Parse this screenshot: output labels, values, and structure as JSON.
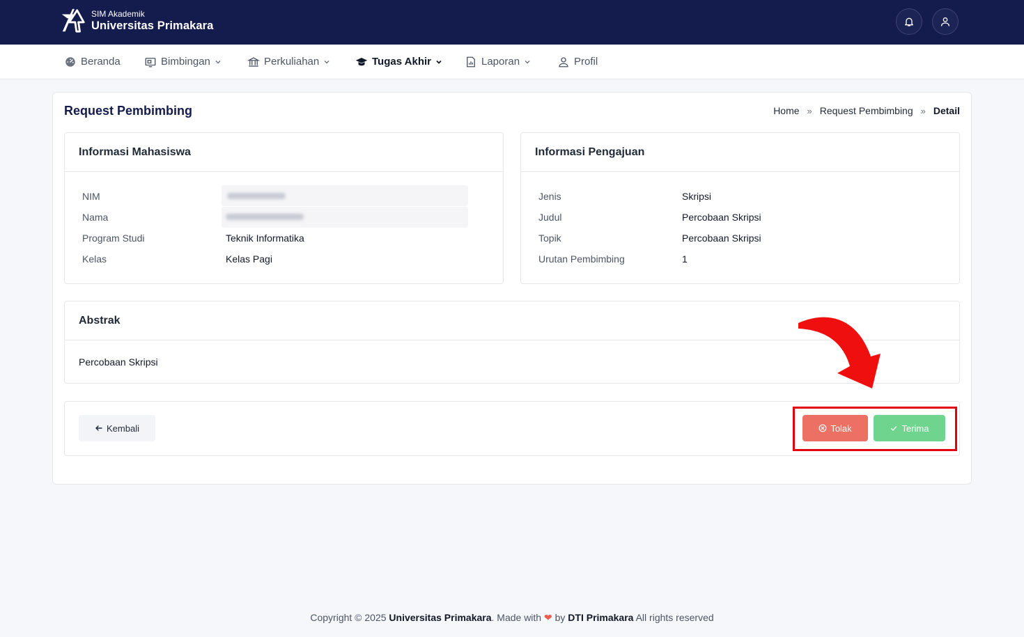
{
  "header": {
    "app_small": "SIM Akademik",
    "app_name": "Universitas Primakara",
    "icons": [
      "bell-icon",
      "user-icon"
    ]
  },
  "nav": {
    "items": [
      {
        "label": "Beranda",
        "icon": "dashboard-icon"
      },
      {
        "label": "Bimbingan",
        "icon": "monitor-icon",
        "dropdown": true
      },
      {
        "label": "Perkuliahan",
        "icon": "building-icon",
        "dropdown": true
      },
      {
        "label": "Tugas Akhir",
        "icon": "graduation-cap-icon",
        "dropdown": true,
        "active": true
      },
      {
        "label": "Laporan",
        "icon": "report-icon",
        "dropdown": true
      },
      {
        "label": "Profil",
        "icon": "user-icon"
      }
    ]
  },
  "page": {
    "title": "Request Pembimbing",
    "breadcrumb": [
      "Home",
      "Request Pembimbing",
      "Detail"
    ]
  },
  "student_info": {
    "title": "Informasi Mahasiswa",
    "rows": [
      {
        "label": "NIM",
        "value": "",
        "redacted": true
      },
      {
        "label": "Nama",
        "value": "",
        "redacted": true
      },
      {
        "label": "Program Studi",
        "value": "Teknik Informatika"
      },
      {
        "label": "Kelas",
        "value": "Kelas Pagi"
      }
    ]
  },
  "submission_info": {
    "title": "Informasi Pengajuan",
    "rows": [
      {
        "label": "Jenis",
        "value": "Skripsi"
      },
      {
        "label": "Judul",
        "value": "Percobaan Skripsi"
      },
      {
        "label": "Topik",
        "value": "Percobaan Skripsi"
      },
      {
        "label": "Urutan Pembimbing",
        "value": "1"
      }
    ]
  },
  "abstract": {
    "title": "Abstrak",
    "text": "Percobaan Skripsi"
  },
  "actions": {
    "back_label": "Kembali",
    "reject_label": "Tolak",
    "accept_label": "Terima"
  },
  "colors": {
    "header_bg": "#141b4d",
    "reject": "#ec7063",
    "accept": "#6fd58e",
    "annotation": "#e3000f"
  },
  "footer": {
    "copyright": "Copyright © 2025",
    "org": "Universitas Primakara",
    "made_with": ". Made with",
    "by": "by",
    "team": "DTI Primakara",
    "rights": "All rights reserved"
  }
}
